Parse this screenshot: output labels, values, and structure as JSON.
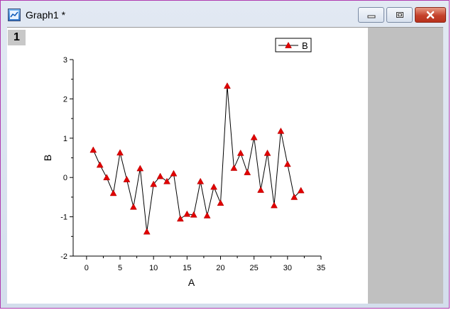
{
  "window": {
    "title": "Graph1 *",
    "layer_number": "1",
    "frame_color": "#b03bb0",
    "close_color": "#c4412b"
  },
  "chart_data": {
    "type": "line",
    "xlabel": "A",
    "ylabel": "B",
    "xlim": [
      -2,
      35
    ],
    "ylim": [
      -2,
      3
    ],
    "xticks": [
      "0",
      "5",
      "10",
      "15",
      "20",
      "25",
      "30",
      "35"
    ],
    "yticks": [
      "-2",
      "-1",
      "0",
      "1",
      "2",
      "3"
    ],
    "legend_position": "top-right",
    "marker": "triangle",
    "marker_color": "#e00000",
    "line_color": "#000000",
    "series": [
      {
        "name": "B",
        "x": [
          1,
          2,
          3,
          4,
          5,
          6,
          7,
          8,
          9,
          10,
          11,
          12,
          13,
          14,
          15,
          16,
          17,
          18,
          19,
          20,
          21,
          22,
          23,
          24,
          25,
          26,
          27,
          28,
          29,
          30,
          31,
          32
        ],
        "y": [
          0.7,
          0.32,
          0.0,
          -0.4,
          0.63,
          -0.05,
          -0.75,
          0.23,
          -1.38,
          -0.17,
          0.03,
          -0.1,
          0.1,
          -1.05,
          -0.93,
          -0.95,
          -0.1,
          -0.97,
          -0.24,
          -0.65,
          2.33,
          0.24,
          0.62,
          0.13,
          1.02,
          -0.32,
          0.62,
          -0.71,
          1.18,
          0.34,
          -0.5,
          -0.33
        ]
      }
    ]
  }
}
